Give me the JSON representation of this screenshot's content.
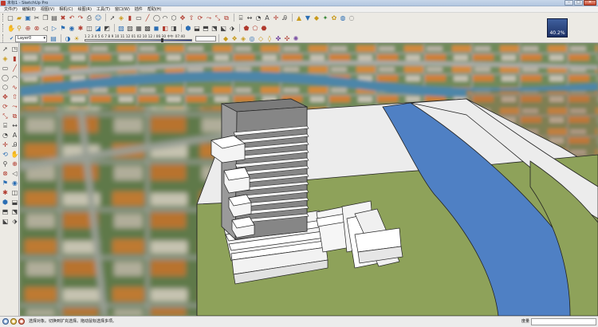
{
  "window": {
    "title": "未标1 - SketchUp Pro",
    "min_label": "–",
    "max_label": "□",
    "close_label": "✕"
  },
  "menubar": {
    "items": [
      "文件(F)",
      "编辑(E)",
      "视图(V)",
      "相机(C)",
      "绘图(R)",
      "工具(T)",
      "窗口(W)",
      "插件",
      "帮助(H)"
    ]
  },
  "toolbar": {
    "layer_name": "Layer0",
    "shadow_scale": "1 2 3 4 5 6 7 8 9 10 11 12  01 02 10 12 / 06:30  中午  07:40",
    "shadow_time": "",
    "zoom_badge": "40.2%"
  },
  "status": {
    "hint": "选择对象。切换到扩充选择。拖动鼠标选择多项。",
    "measure_label": "度量",
    "measure_value": ""
  },
  "colors": {
    "sky": "#f0f0f0",
    "river": "#4f80c4",
    "lawn": "#8ea25a",
    "building_roof": "#7a7a7a",
    "building_side": "#8f8f8f",
    "podium": "#f4f4f4"
  },
  "icons": {
    "toolbar_row1": [
      "new-file-icon",
      "open-icon",
      "save-icon",
      "cut-icon",
      "copy-icon",
      "paste-icon",
      "erase-icon",
      "undo-icon",
      "redo-icon",
      "print-icon",
      "user-icon",
      "model-info-icon",
      "select-icon",
      "paint-icon",
      "eraser-icon",
      "rectangle-icon",
      "circle-icon",
      "polygon-icon",
      "arc-icon",
      "freehand-icon",
      "push-pull-icon",
      "move-icon",
      "rotate-icon",
      "scale-icon",
      "offset-icon",
      "tape-icon",
      "dimension-icon",
      "protractor-icon",
      "text-icon",
      "axes-icon",
      "3d-text-icon"
    ],
    "toolbar_row3_right": [
      "sandbox-icon",
      "contours-icon",
      "scratch-icon",
      "smoove-icon",
      "stamp-icon",
      "drape-icon",
      "add-detail-icon",
      "flip-edge-icon",
      "color-wheel-icon"
    ],
    "left_tools": [
      "select-icon",
      "make-component-icon",
      "paint-bucket-icon",
      "eraser-icon",
      "rectangle-icon",
      "line-icon",
      "circle-icon",
      "arc-icon",
      "polygon-icon",
      "freehand-icon",
      "move-icon",
      "push-pull-icon",
      "rotate-icon",
      "follow-me-icon",
      "scale-icon",
      "offset-icon",
      "tape-measure-icon",
      "dimension-icon",
      "protractor-icon",
      "text-icon",
      "axes-icon",
      "3d-text-icon",
      "orbit-icon",
      "pan-icon",
      "zoom-icon",
      "zoom-window-icon",
      "zoom-extents-icon",
      "previous-view-icon",
      "position-camera-icon",
      "look-around-icon",
      "walk-icon",
      "section-plane-icon",
      "iso-view-icon",
      "top-view-icon",
      "front-view-icon",
      "right-view-icon",
      "back-view-icon",
      "left-view-icon"
    ]
  }
}
